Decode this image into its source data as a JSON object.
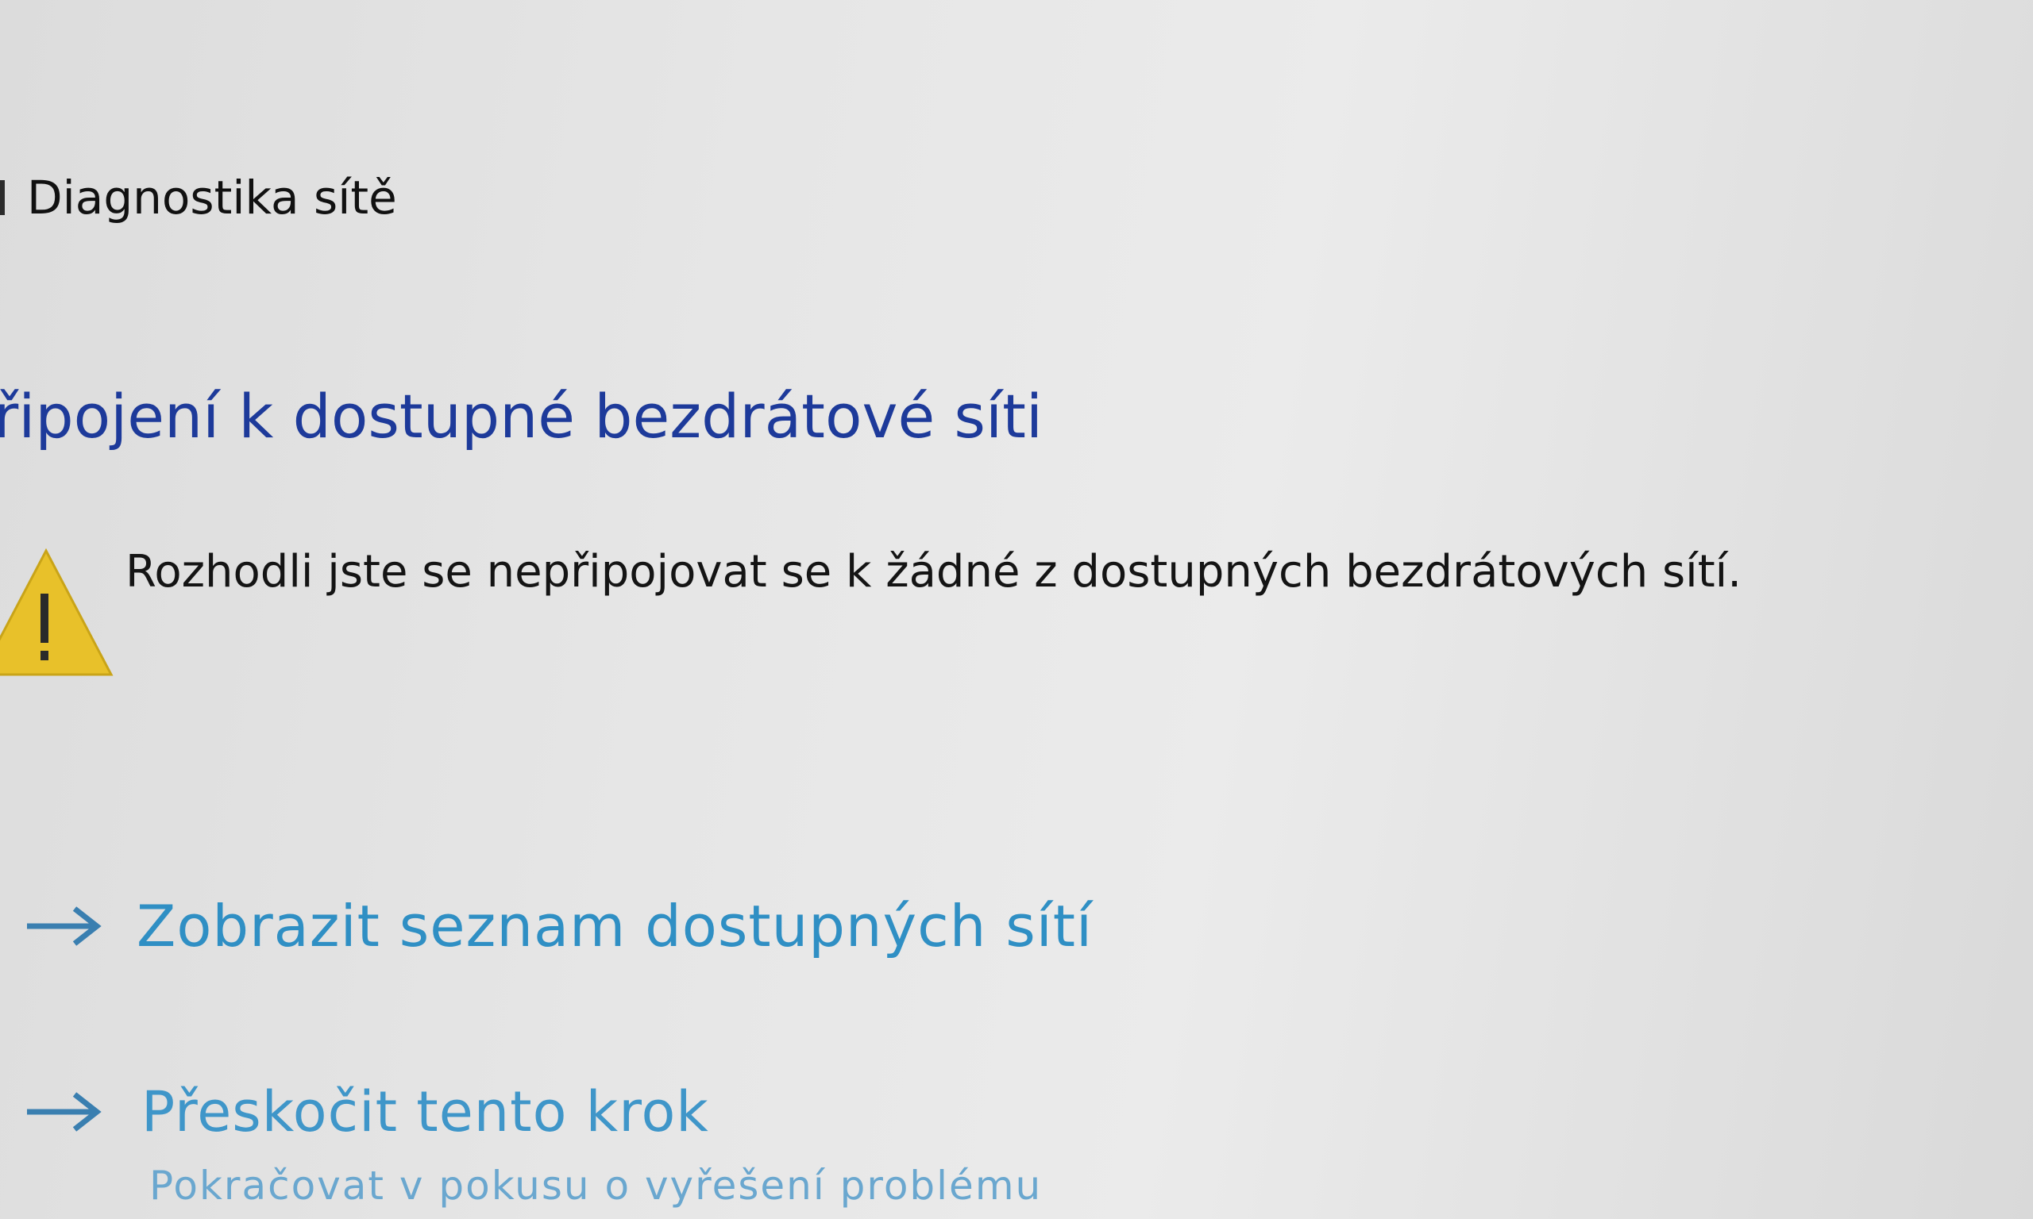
{
  "window": {
    "title": "Diagnostika sítě"
  },
  "main": {
    "heading": "řipojení k dostupné bezdrátové síti",
    "message": "Rozhodli jste se nepřipojovat se k žádné z dostupných bezdrátových sítí."
  },
  "options": [
    {
      "label": "Zobrazit seznam dostupných sítí",
      "icon": "arrow-right-icon"
    },
    {
      "label": "Přeskočit tento krok",
      "description": "Pokračovat v pokusu o vyřešení problému",
      "icon": "arrow-right-icon"
    }
  ],
  "colors": {
    "heading": "#1d3a9a",
    "link": "#2f8fc4",
    "warning": "#e8c12a"
  }
}
